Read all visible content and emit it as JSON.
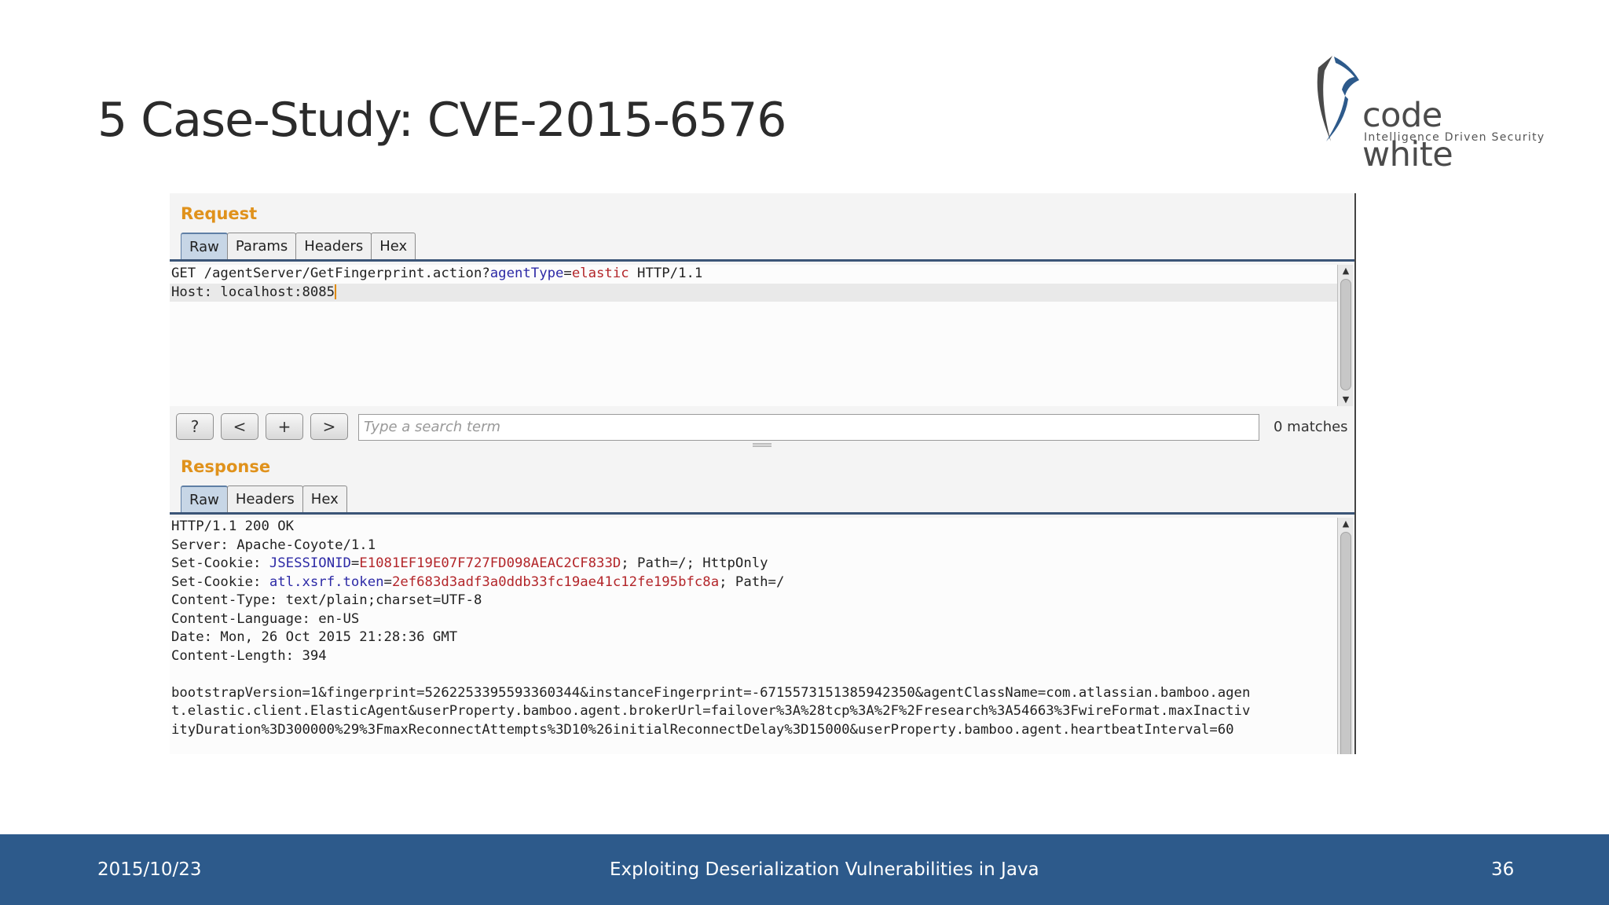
{
  "slide": {
    "title": "5 Case-Study: CVE-2015-6576"
  },
  "logo": {
    "word": "code white",
    "tagline": "Intelligence Driven Security"
  },
  "request": {
    "heading": "Request",
    "tabs": [
      "Raw",
      "Params",
      "Headers",
      "Hex"
    ],
    "active_tab": "Raw",
    "line1": {
      "prefix": "GET /agentServer/GetFingerprint.action?",
      "param_name": "agentType",
      "eq": "=",
      "param_value": "elastic",
      "suffix": " HTTP/1.1"
    },
    "line2": "Host: localhost:8085"
  },
  "search": {
    "help_label": "?",
    "prev_label": "<",
    "add_label": "+",
    "next_label": ">",
    "placeholder": "Type a search term",
    "matches": "0 matches"
  },
  "response": {
    "heading": "Response",
    "tabs": [
      "Raw",
      "Headers",
      "Hex"
    ],
    "active_tab": "Raw",
    "status": "HTTP/1.1 200 OK",
    "server": "Server: Apache-Coyote/1.1",
    "cookie1": {
      "prefix": "Set-Cookie: ",
      "name": "JSESSIONID",
      "eq": "=",
      "value": "E1081EF19E07F727FD098AEAC2CF833D",
      "suffix": "; Path=/; HttpOnly"
    },
    "cookie2": {
      "prefix": "Set-Cookie: ",
      "name": "atl.xsrf.token",
      "eq": "=",
      "value": "2ef683d3adf3a0ddb33fc19ae41c12fe195bfc8a",
      "suffix": "; Path=/"
    },
    "content_type": "Content-Type: text/plain;charset=UTF-8",
    "content_language": "Content-Language: en-US",
    "date": "Date: Mon, 26 Oct 2015 21:28:36 GMT",
    "content_length": "Content-Length: 394",
    "body_lines": [
      "bootstrapVersion=1&fingerprint=5262253395593360344&instanceFingerprint=-6715573151385942350&agentClassName=com.atlassian.bamboo.agen",
      "t.elastic.client.ElasticAgent&userProperty.bamboo.agent.brokerUrl=failover%3A%28tcp%3A%2F%2Fresearch%3A54663%3FwireFormat.maxInactiv",
      "ityDuration%3D300000%29%3FmaxReconnectAttempts%3D10%26initialReconnectDelay%3D15000&userProperty.bamboo.agent.heartbeatInterval=60"
    ]
  },
  "footer": {
    "date": "2015/10/23",
    "title": "Exploiting Deserialization Vulnerabilities in Java",
    "page": "36"
  }
}
